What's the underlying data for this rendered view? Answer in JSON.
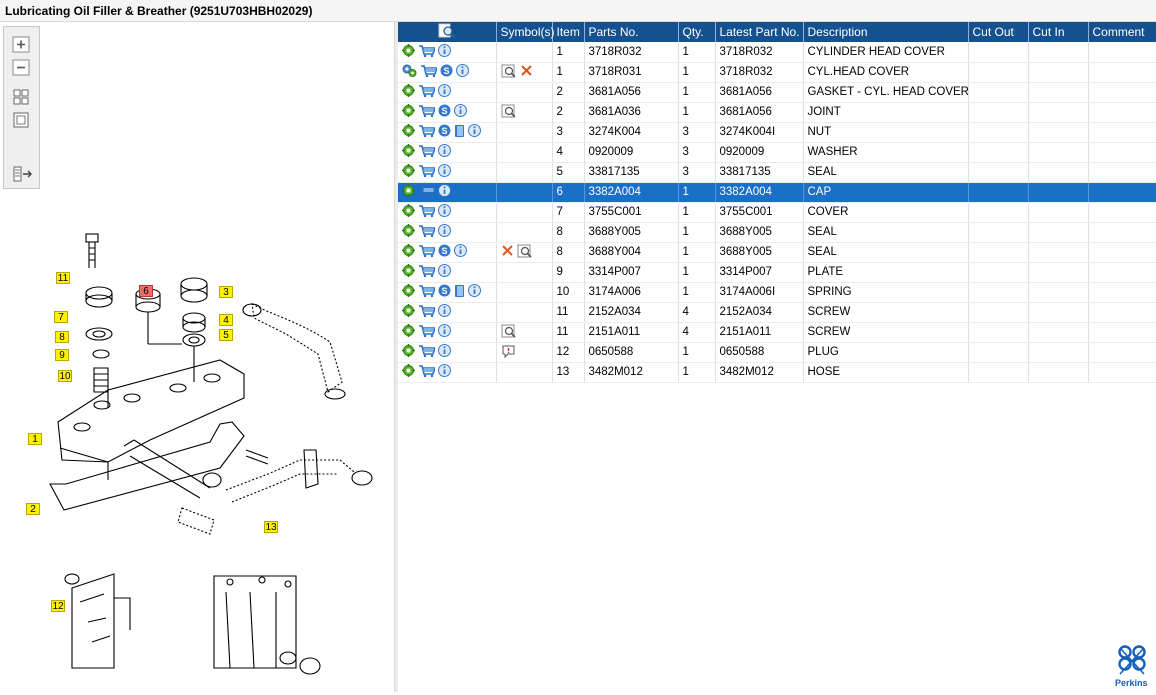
{
  "window": {
    "title": "Lubricating Oil Filler & Breather (9251U703HBH02029)"
  },
  "toolbar": {
    "icons": [
      "zoom-in-icon",
      "zoom-out-icon",
      "fit-all-icon",
      "fit-window-icon",
      "show-parts-list-icon"
    ]
  },
  "diagram": {
    "callouts": [
      "11",
      "7",
      "8",
      "9",
      "10",
      "6",
      "3",
      "4",
      "5",
      "1",
      "2",
      "13",
      "12"
    ]
  },
  "table": {
    "columns": [
      "",
      "Symbol(s)",
      "Item",
      "Parts No.",
      "Qty.",
      "Latest Part No.",
      "Description",
      "Cut Out",
      "Cut In",
      "Comment"
    ],
    "rows": [
      {
        "actions": [
          "gear",
          "cart",
          "info"
        ],
        "symbols": [],
        "item": "1",
        "part_no": "3718R032",
        "qty": "1",
        "latest": "3718R032",
        "desc": "CYLINDER HEAD COVER"
      },
      {
        "actions": [
          "gears",
          "cart",
          "s",
          "info"
        ],
        "symbols": [
          "zoom",
          "cross"
        ],
        "item": "1",
        "part_no": "3718R031",
        "qty": "1",
        "latest": "3718R032",
        "desc": "CYL.HEAD COVER"
      },
      {
        "actions": [
          "gear",
          "cart",
          "info"
        ],
        "symbols": [],
        "item": "2",
        "part_no": "3681A056",
        "qty": "1",
        "latest": "3681A056",
        "desc": "GASKET - CYL. HEAD COVER"
      },
      {
        "actions": [
          "gear",
          "cart",
          "s",
          "info"
        ],
        "symbols": [
          "zoom"
        ],
        "item": "2",
        "part_no": "3681A036",
        "qty": "1",
        "latest": "3681A056",
        "desc": "JOINT"
      },
      {
        "actions": [
          "gear",
          "cart",
          "s",
          "book",
          "info"
        ],
        "symbols": [],
        "item": "3",
        "part_no": "3274K004",
        "qty": "3",
        "latest": "3274K004I",
        "desc": "NUT"
      },
      {
        "actions": [
          "gear",
          "cart",
          "info"
        ],
        "symbols": [],
        "item": "4",
        "part_no": "0920009",
        "qty": "3",
        "latest": "0920009",
        "desc": "WASHER"
      },
      {
        "actions": [
          "gear",
          "cart",
          "info"
        ],
        "symbols": [],
        "item": "5",
        "part_no": "33817135",
        "qty": "3",
        "latest": "33817135",
        "desc": "SEAL"
      },
      {
        "actions": [
          "gear",
          "cart",
          "info"
        ],
        "symbols": [],
        "item": "6",
        "part_no": "3382A004",
        "qty": "1",
        "latest": "3382A004",
        "desc": "CAP",
        "selected": true
      },
      {
        "actions": [
          "gear",
          "cart",
          "info"
        ],
        "symbols": [],
        "item": "7",
        "part_no": "3755C001",
        "qty": "1",
        "latest": "3755C001",
        "desc": "COVER"
      },
      {
        "actions": [
          "gear",
          "cart",
          "info"
        ],
        "symbols": [],
        "item": "8",
        "part_no": "3688Y005",
        "qty": "1",
        "latest": "3688Y005",
        "desc": "SEAL"
      },
      {
        "actions": [
          "gear",
          "cart",
          "s",
          "info"
        ],
        "symbols": [
          "cross",
          "zoom"
        ],
        "item": "8",
        "part_no": "3688Y004",
        "qty": "1",
        "latest": "3688Y005",
        "desc": "SEAL"
      },
      {
        "actions": [
          "gear",
          "cart",
          "info"
        ],
        "symbols": [],
        "item": "9",
        "part_no": "3314P007",
        "qty": "1",
        "latest": "3314P007",
        "desc": "PLATE"
      },
      {
        "actions": [
          "gear",
          "cart",
          "s",
          "book",
          "info"
        ],
        "symbols": [],
        "item": "10",
        "part_no": "3174A006",
        "qty": "1",
        "latest": "3174A006I",
        "desc": "SPRING"
      },
      {
        "actions": [
          "gear",
          "cart",
          "info"
        ],
        "symbols": [],
        "item": "11",
        "part_no": "2152A034",
        "qty": "4",
        "latest": "2152A034",
        "desc": "SCREW"
      },
      {
        "actions": [
          "gear",
          "cart",
          "info"
        ],
        "symbols": [
          "zoom"
        ],
        "item": "11",
        "part_no": "2151A011",
        "qty": "4",
        "latest": "2151A011",
        "desc": "SCREW"
      },
      {
        "actions": [
          "gear",
          "cart",
          "info"
        ],
        "symbols": [
          "comment"
        ],
        "item": "12",
        "part_no": "0650588",
        "qty": "1",
        "latest": "0650588",
        "desc": "PLUG"
      },
      {
        "actions": [
          "gear",
          "cart",
          "info"
        ],
        "symbols": [],
        "item": "13",
        "part_no": "3482M012",
        "qty": "1",
        "latest": "3482M012",
        "desc": "HOSE"
      }
    ]
  },
  "brand": {
    "name": "Perkins",
    "color": "#1560bd"
  },
  "colors": {
    "header": "#15518e",
    "selection": "#1a6fc9",
    "callout": "#fff200"
  }
}
